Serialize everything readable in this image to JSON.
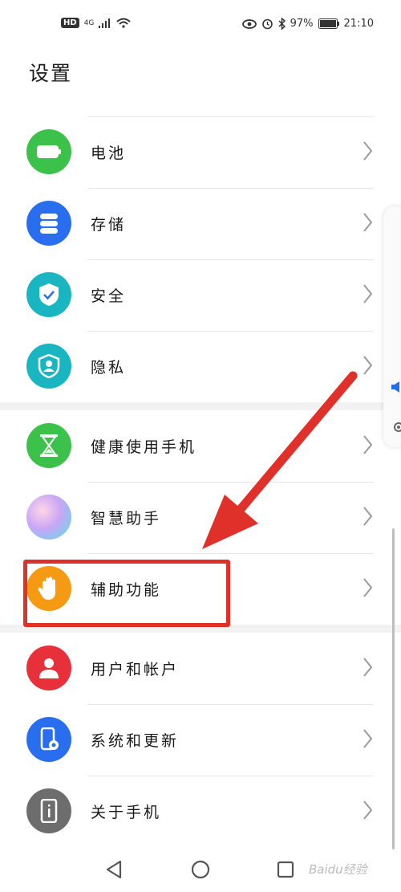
{
  "status": {
    "hd": "HD",
    "network": "4G",
    "battery": "97%",
    "time": "21:10"
  },
  "page_title": "设置",
  "groups": [
    [
      {
        "label": "电池",
        "icon": "battery-icon",
        "color": "#3cc14a"
      },
      {
        "label": "存储",
        "icon": "storage-icon",
        "color": "#2a6ef0"
      },
      {
        "label": "安全",
        "icon": "shield-check-icon",
        "color": "#19b6c2"
      },
      {
        "label": "隐私",
        "icon": "privacy-icon",
        "color": "#19b6c2"
      }
    ],
    [
      {
        "label": "健康使用手机",
        "icon": "hourglass-icon",
        "color": "#3cc14a"
      },
      {
        "label": "智慧助手",
        "icon": "assistant-icon",
        "color": "#b48ef0"
      },
      {
        "label": "辅助功能",
        "icon": "hand-icon",
        "color": "#f59a12"
      }
    ],
    [
      {
        "label": "用户和帐户",
        "icon": "user-icon",
        "color": "#e8303a"
      },
      {
        "label": "系统和更新",
        "icon": "system-update-icon",
        "color": "#2a6ef0"
      },
      {
        "label": "关于手机",
        "icon": "phone-info-icon",
        "color": "#6d6d6d"
      }
    ]
  ],
  "annotation_color": "#e0302a",
  "watermark": "Baidu经验"
}
